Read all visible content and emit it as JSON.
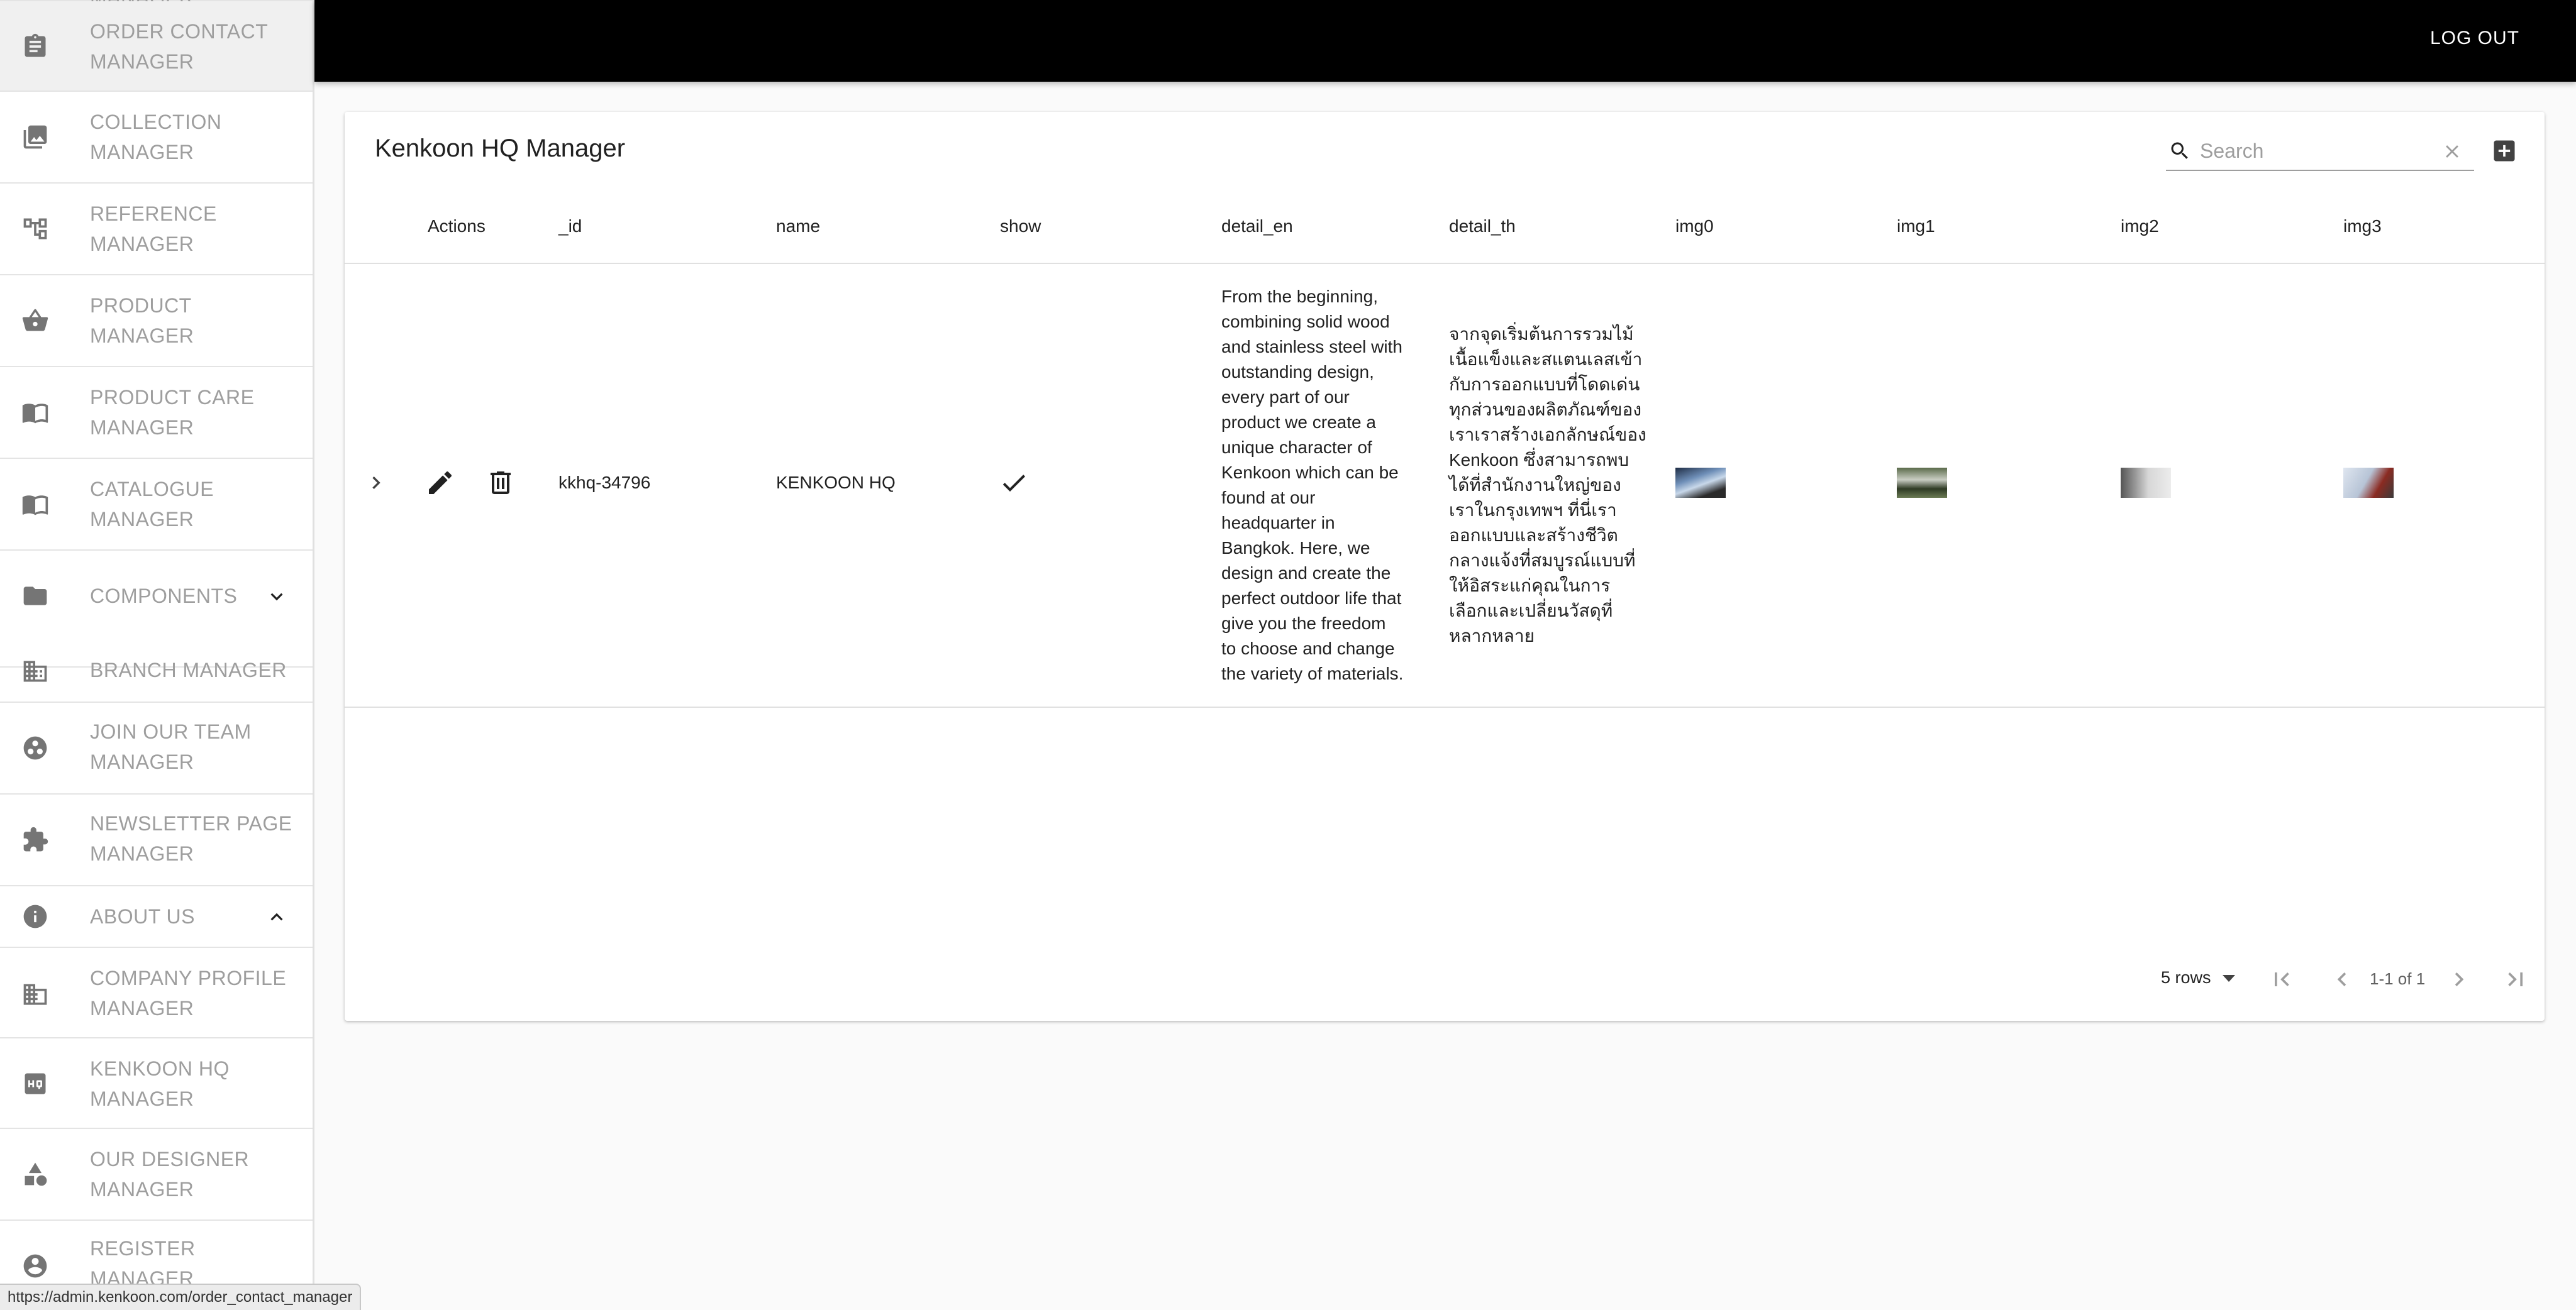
{
  "sidebar": {
    "top_partial_label": "MANAGER",
    "items": [
      {
        "label": "ORDER CONTACT MANAGER",
        "icon": "clipboard-icon"
      },
      {
        "label": "COLLECTION MANAGER",
        "icon": "photo-library-icon"
      },
      {
        "label": "REFERENCE MANAGER",
        "icon": "account-tree-icon"
      },
      {
        "label": "PRODUCT MANAGER",
        "icon": "basket-icon"
      },
      {
        "label": "PRODUCT CARE MANAGER",
        "icon": "open-book-icon"
      },
      {
        "label": "CATALOGUE MANAGER",
        "icon": "open-book-icon"
      },
      {
        "label": "COMPONENTS",
        "icon": "folder-icon"
      },
      {
        "label": "BRANCH MANAGER",
        "icon": "business-icon"
      },
      {
        "label": "JOIN OUR TEAM MANAGER",
        "icon": "group-work-icon"
      },
      {
        "label": "NEWSLETTER PAGE MANAGER",
        "icon": "extension-icon"
      },
      {
        "label": "ABOUT US",
        "icon": "info-icon"
      },
      {
        "label": "COMPANY PROFILE MANAGER",
        "icon": "domain-icon"
      },
      {
        "label": "KENKOON HQ MANAGER",
        "icon": "hq-icon"
      },
      {
        "label": "OUR DESIGNER MANAGER",
        "icon": "category-icon"
      },
      {
        "label": "REGISTER MANAGER",
        "icon": "account-circle-icon"
      }
    ]
  },
  "topbar": {
    "logout_label": "LOG OUT"
  },
  "card": {
    "title": "Kenkoon HQ Manager",
    "search_placeholder": "Search"
  },
  "table": {
    "columns": [
      "Actions",
      "_id",
      "name",
      "show",
      "detail_en",
      "detail_th",
      "img0",
      "img1",
      "img2",
      "img3"
    ],
    "rows": [
      {
        "_id": "kkhq-34796",
        "name": "KENKOON HQ",
        "show": true,
        "detail_en_lines": [
          "From the beginning,",
          "combining solid wood",
          "and stainless steel with",
          "outstanding design,",
          "every part of our",
          "product we create a",
          "unique character of",
          "Kenkoon which can be",
          "found at our",
          "headquarter in",
          "Bangkok. Here, we",
          "design and create the",
          "perfect outdoor life that",
          "give you the freedom",
          "to choose and change",
          "the variety of materials."
        ],
        "detail_th_lines": [
          "จากจุดเริ่มต้นการรวมไม้",
          "เนื้อแข็งและสแตนเลสเข้า",
          "กับการออกแบบที่โดดเด่น",
          "ทุกส่วนของผลิตภัณฑ์ของ",
          "เราเราสร้างเอกลักษณ์ของ",
          "Kenkoon ซึ่งสามารถพบ",
          "ได้ที่สำนักงานใหญ่ของ",
          "เราในกรุงเทพฯ ที่นี่เรา",
          "ออกแบบและสร้างชีวิต",
          "กลางแจ้งที่สมบูรณ์แบบที่",
          "ให้อิสระแก่คุณในการ",
          "เลือกและเปลี่ยนวัสดุที่",
          "หลากหลาย"
        ]
      }
    ]
  },
  "footer": {
    "rows_per_page": "5 rows",
    "page_info": "1-1 of 1"
  },
  "status_url": "https://admin.kenkoon.com/order_contact_manager"
}
